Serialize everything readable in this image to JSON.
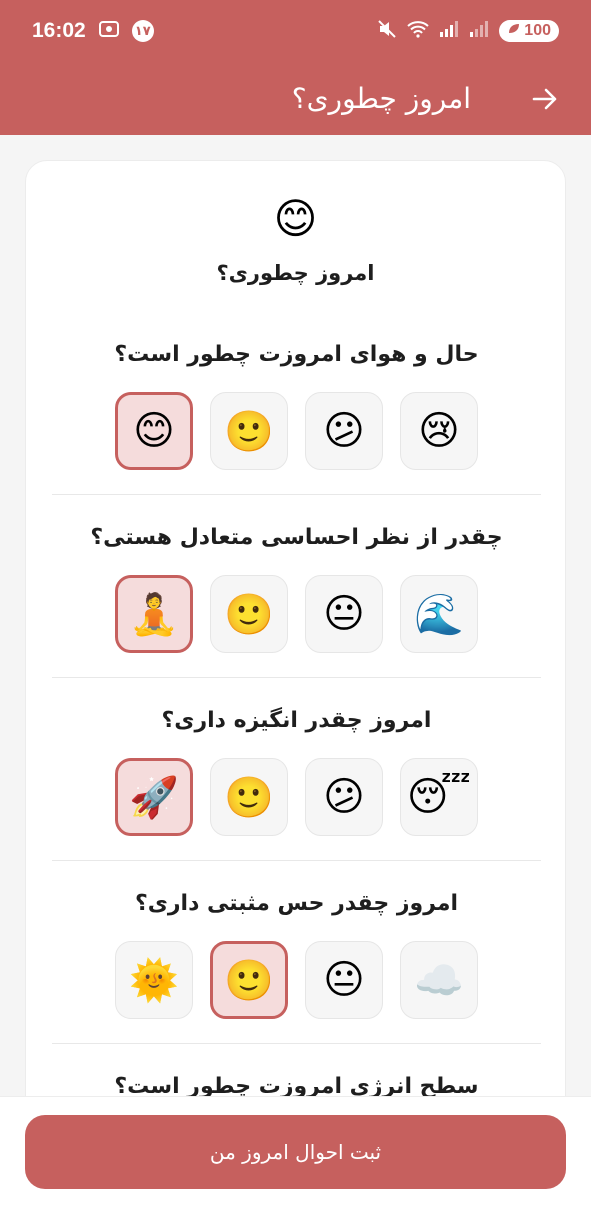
{
  "status_bar": {
    "time": "16:02",
    "notification_count": "۱۷",
    "battery": "100"
  },
  "app_bar": {
    "title": "امروز چطوری؟"
  },
  "card": {
    "header_emoji": "😊",
    "header_title": "امروز چطوری؟",
    "questions": [
      {
        "title": "حال و هوای امروزت چطور است؟",
        "options": [
          "😢",
          "😕",
          "🙂",
          "😊"
        ],
        "selected_index": 3
      },
      {
        "title": "چقدر از نظر احساسی متعادل هستی؟",
        "options": [
          "🌊",
          "😐",
          "🙂",
          "🧘"
        ],
        "selected_index": 3
      },
      {
        "title": "امروز چقدر انگیزه داری؟",
        "options": [
          "😴",
          "😕",
          "🙂",
          "🚀"
        ],
        "selected_index": 3
      },
      {
        "title": "امروز چقدر حس مثبتی داری؟",
        "options": [
          "☁️",
          "😐",
          "🙂",
          "🌞"
        ],
        "selected_index": 2
      },
      {
        "title": "سطح انرژی امروزت چطور است؟"
      }
    ]
  },
  "submit_button": {
    "label": "ثبت احوال امروز من"
  },
  "colors": {
    "primary": "#c6605e",
    "selected_bg": "#f5dcdc"
  }
}
